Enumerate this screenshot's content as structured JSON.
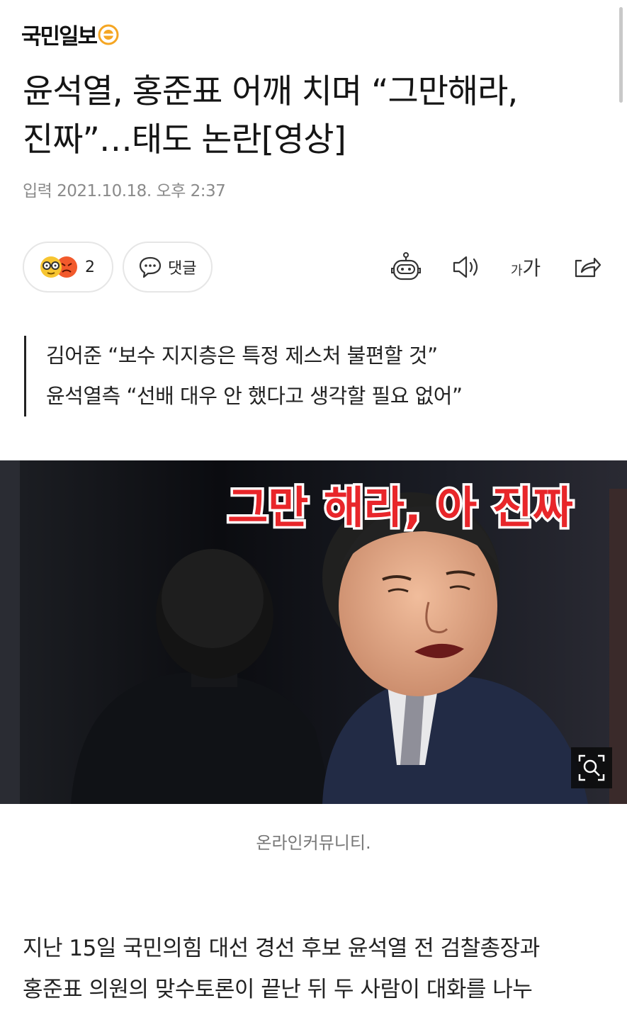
{
  "brand": {
    "name": "국민일보"
  },
  "article": {
    "headline_line1": "윤석열, 홍준표 어깨 치며 “그만해라,",
    "headline_line2": "진짜”…태도 논란[영상]",
    "byline": "입력 2021.10.18. 오후 2:37"
  },
  "actions": {
    "reaction_count": "2",
    "comment_label": "댓글",
    "font_small": "가",
    "font_big": "가",
    "icons": [
      "robot-icon",
      "speaker-icon",
      "font-size-icon",
      "share-icon"
    ]
  },
  "subheadlines": [
    "김어준 “보수 지지층은 특정 제스처 불편할 것”",
    "윤석열측 “선배 대우 안 했다고 생각할 필요 없어”"
  ],
  "image": {
    "overlay_text": "그만 해라, 아 진짜",
    "caption": "온라인커뮤니티."
  },
  "body": {
    "lines": [
      "지난 15일 국민의힘 대선 경선 후보 윤석열 전 검찰총장과",
      "홍준표 의원의 맞수토론이 끝난 뒤 두 사람이 대화를 나누"
    ]
  },
  "colors": {
    "brand_accent": "#f5a623",
    "overlay_text": "#e8262a"
  }
}
